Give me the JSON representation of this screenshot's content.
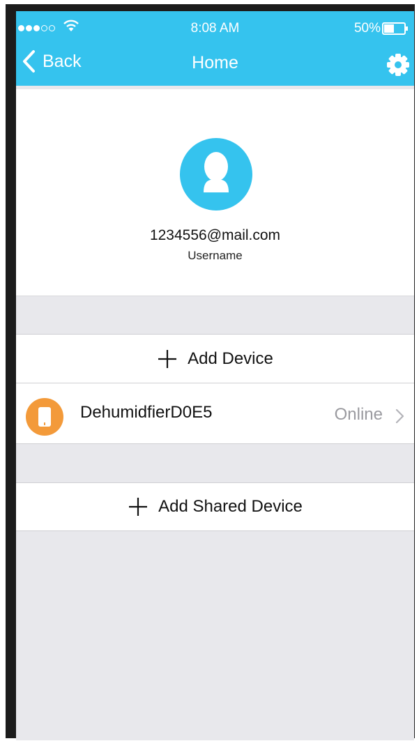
{
  "status_bar": {
    "time": "8:08 AM",
    "battery_percent": "50%",
    "battery_level": 0.5,
    "signal_bars_filled": 3,
    "signal_bars_total": 5
  },
  "nav": {
    "back_label": "Back",
    "title": "Home",
    "settings_icon": "gear-icon"
  },
  "profile": {
    "email": "1234556@mail.com",
    "username": "Username"
  },
  "actions": {
    "add_device_label": "Add Device",
    "add_shared_label": "Add Shared Device"
  },
  "devices": [
    {
      "name": "DehumidfierD0E5",
      "status": "Online",
      "icon": "dehumidifier-icon"
    }
  ],
  "colors": {
    "accent": "#35c3ee",
    "device_icon": "#f39a3a",
    "background": "#e8e8ec",
    "status_gray": "#9a9a9f"
  }
}
